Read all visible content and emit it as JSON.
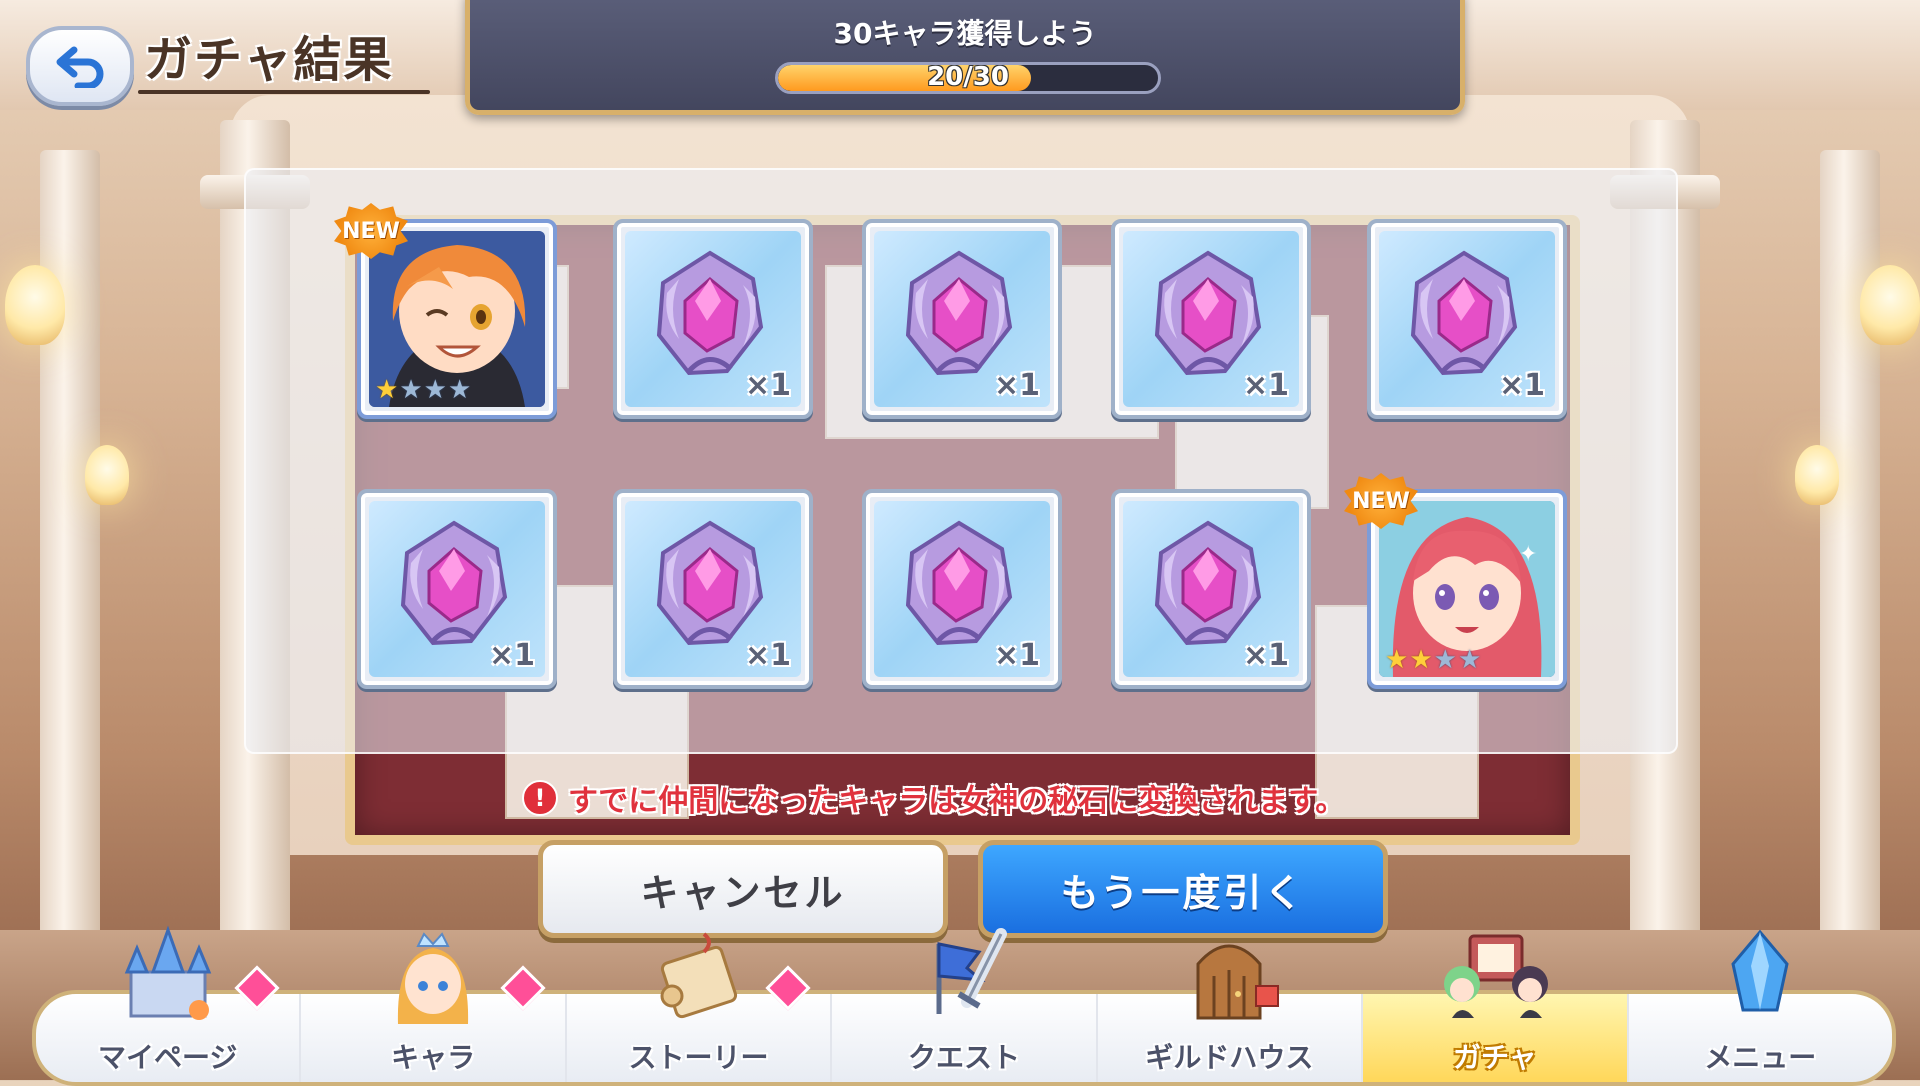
{
  "header": {
    "title": "ガチャ結果",
    "mission_text": "30キャラ獲得しよう",
    "progress_text": "20/30",
    "progress_fraction": 0.667
  },
  "results": {
    "row1": [
      {
        "kind": "character",
        "new_label": "NEW",
        "stars_on": 1,
        "stars_total": 4,
        "portrait": "orange-hair-winking-girl"
      },
      {
        "kind": "item",
        "item": "goddess-stone-icon",
        "qty": "×1"
      },
      {
        "kind": "item",
        "item": "goddess-stone-icon",
        "qty": "×1"
      },
      {
        "kind": "item",
        "item": "goddess-stone-icon",
        "qty": "×1"
      },
      {
        "kind": "item",
        "item": "goddess-stone-icon",
        "qty": "×1"
      }
    ],
    "row2": [
      {
        "kind": "item",
        "item": "goddess-stone-icon",
        "qty": "×1"
      },
      {
        "kind": "item",
        "item": "goddess-stone-icon",
        "qty": "×1"
      },
      {
        "kind": "item",
        "item": "goddess-stone-icon",
        "qty": "×1"
      },
      {
        "kind": "item",
        "item": "goddess-stone-icon",
        "qty": "×1"
      },
      {
        "kind": "character",
        "new_label": "NEW",
        "stars_on": 2,
        "stars_total": 4,
        "portrait": "red-hair-smiling-girl"
      }
    ]
  },
  "notice": {
    "icon": "!",
    "text": "すでに仲間になったキャラは女神の秘石に変換されます。"
  },
  "buttons": {
    "cancel": "キャンセル",
    "draw_again": "もう一度引く"
  },
  "nav": {
    "items": [
      {
        "label": "マイページ",
        "icon": "castle-icon",
        "badge": true
      },
      {
        "label": "キャラ",
        "icon": "princess-icon",
        "badge": true
      },
      {
        "label": "ストーリー",
        "icon": "scroll-icon",
        "badge": true
      },
      {
        "label": "クエスト",
        "icon": "sword-flag-icon",
        "badge": false
      },
      {
        "label": "ギルドハウス",
        "icon": "guild-door-icon",
        "badge": false
      },
      {
        "label": "ガチャ",
        "icon": "gacha-board-icon",
        "badge": false,
        "active": true
      },
      {
        "label": "メニュー",
        "icon": "crystal-icon",
        "badge": false
      }
    ]
  },
  "colors": {
    "accent_blue": "#1a6fe0",
    "notice_red": "#e0323d",
    "progress_orange": "#ff9a1f",
    "badge_pink": "#ff4f98",
    "gold_border": "#c6a065"
  }
}
